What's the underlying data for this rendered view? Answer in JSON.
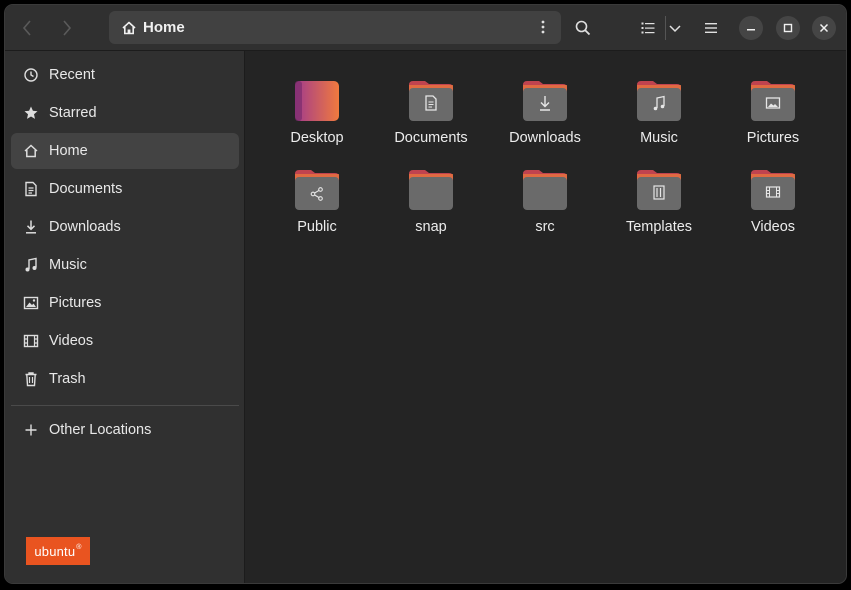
{
  "header": {
    "back_icon": "chevron-left-icon",
    "forward_icon": "chevron-right-icon",
    "path_title": "Home",
    "path_icon": "home-icon",
    "menu_icon": "vertical-dots-icon",
    "search_icon": "search-icon",
    "list_view_icon": "list-view-icon",
    "view_options_icon": "chevron-down-icon",
    "main_menu_icon": "hamburger-menu-icon",
    "minimize_icon": "minimize-icon",
    "maximize_icon": "maximize-icon",
    "close_icon": "close-icon"
  },
  "sidebar": {
    "items": [
      {
        "label": "Recent",
        "icon": "clock-icon"
      },
      {
        "label": "Starred",
        "icon": "star-icon"
      },
      {
        "label": "Home",
        "icon": "home-icon",
        "active": true
      },
      {
        "label": "Documents",
        "icon": "document-icon"
      },
      {
        "label": "Downloads",
        "icon": "download-icon"
      },
      {
        "label": "Music",
        "icon": "music-note-icon"
      },
      {
        "label": "Pictures",
        "icon": "picture-icon"
      },
      {
        "label": "Videos",
        "icon": "film-icon"
      },
      {
        "label": "Trash",
        "icon": "trash-icon"
      }
    ],
    "other_locations": {
      "label": "Other Locations",
      "icon": "plus-icon"
    },
    "brand": {
      "text": "ubuntu",
      "mark": "®",
      "color": "#e95420"
    }
  },
  "files": [
    {
      "name": "Desktop",
      "emblem": "none",
      "style": "desktop"
    },
    {
      "name": "Documents",
      "emblem": "document-emblem-icon"
    },
    {
      "name": "Downloads",
      "emblem": "download-emblem-icon"
    },
    {
      "name": "Music",
      "emblem": "music-emblem-icon"
    },
    {
      "name": "Pictures",
      "emblem": "picture-emblem-icon"
    },
    {
      "name": "Public",
      "emblem": "share-emblem-icon"
    },
    {
      "name": "snap",
      "emblem": "none"
    },
    {
      "name": "src",
      "emblem": "none"
    },
    {
      "name": "Templates",
      "emblem": "template-emblem-icon"
    },
    {
      "name": "Videos",
      "emblem": "film-emblem-icon"
    }
  ],
  "colors": {
    "accent": "#e95420",
    "folder_tab": "#c0434f",
    "folder_body": "#6a6a6a",
    "window_bg": "#242424",
    "sidebar_bg": "#303030"
  }
}
